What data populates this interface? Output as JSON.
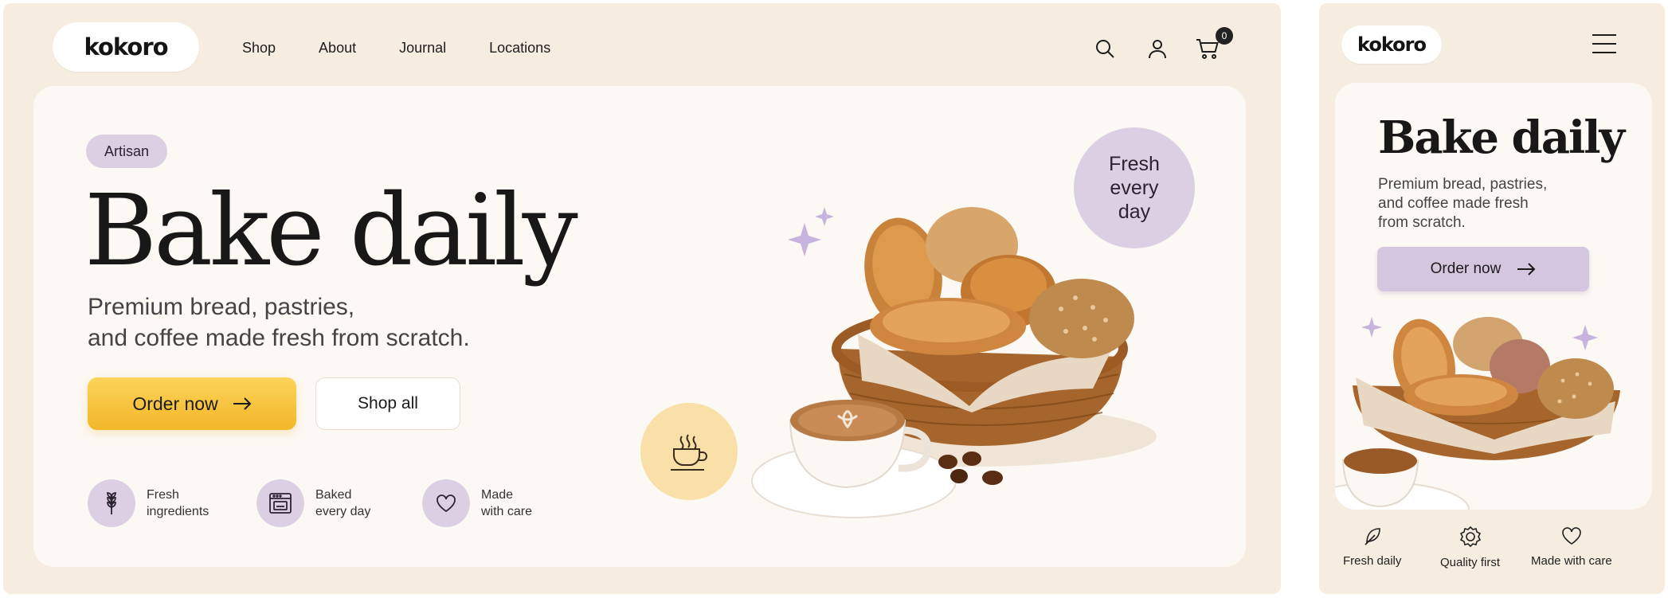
{
  "desktop": {
    "logo": "kokoro",
    "nav": [
      "Shop",
      "About",
      "Journal",
      "Locations"
    ],
    "icons": {
      "search": "search-icon",
      "account": "user-icon",
      "cart": "cart-icon"
    },
    "cart_count": "0",
    "tag": "Artisan",
    "title": "Bake daily",
    "subtitle_line1": "Premium bread, pastries,",
    "subtitle_line2": "and coffee made fresh from scratch.",
    "order_label": "Order now",
    "shop_label": "Shop all",
    "features": [
      {
        "line1": "Fresh",
        "line2": "ingredients",
        "icon": "wheat-icon"
      },
      {
        "line1": "Baked",
        "line2": "every day",
        "icon": "oven-icon"
      },
      {
        "line1": "Made",
        "line2": "with care",
        "icon": "heart-icon"
      }
    ],
    "badge_line1": "Fresh",
    "badge_line2": "every",
    "badge_line3": "day"
  },
  "mobile": {
    "logo": "kokoro",
    "title": "Bake daily",
    "subtitle_line1": "Premium bread, pastries,",
    "subtitle_line2": "and coffee made fresh",
    "subtitle_line3": "from scratch.",
    "order_label": "Order now",
    "features": [
      {
        "label": "Fresh daily",
        "icon": "leaf-icon"
      },
      {
        "label": "Quality first",
        "icon": "badge-icon"
      },
      {
        "label": "Made with care",
        "icon": "heart-icon"
      }
    ]
  },
  "colors": {
    "background": "#f6ede0",
    "card": "#fcf8f3",
    "lavender": "#dccfe4",
    "yellow": "#f6c23e",
    "text": "#181818"
  }
}
